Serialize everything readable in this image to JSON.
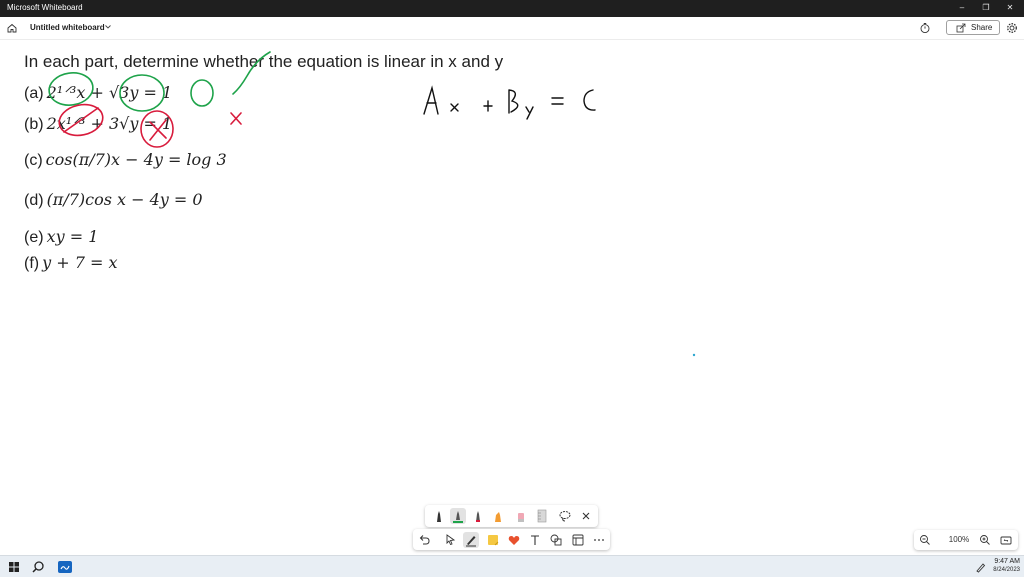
{
  "window": {
    "app_title": "Microsoft Whiteboard"
  },
  "header": {
    "board_title": "Untitled whiteboard",
    "share_label": "Share"
  },
  "problem": {
    "title": "In each part, determine whether the equation is linear in x and y",
    "parts": [
      {
        "label": "(a)",
        "equation": "2¹ᐟ³x + √3y = 1"
      },
      {
        "label": "(b)",
        "equation": "2x¹ᐟ³ + 3√y = 1"
      },
      {
        "label": "(c)",
        "equation": "cos(π/7)x − 4y = log 3"
      },
      {
        "label": "(d)",
        "equation": "(π/7)cos x − 4y = 0"
      },
      {
        "label": "(e)",
        "equation": "xy = 1"
      },
      {
        "label": "(f)",
        "equation": "y + 7 = x"
      }
    ]
  },
  "annotations": {
    "general_form": "Ax + By = C",
    "check_mark": "✓",
    "cross_mark": "✗"
  },
  "ink_colors": {
    "green": "#1ea34a",
    "red": "#d81b3c",
    "black": "#111111"
  },
  "zoom": {
    "level": "100%"
  },
  "clock": {
    "time": "9:47 AM",
    "date": "8/24/2023"
  }
}
